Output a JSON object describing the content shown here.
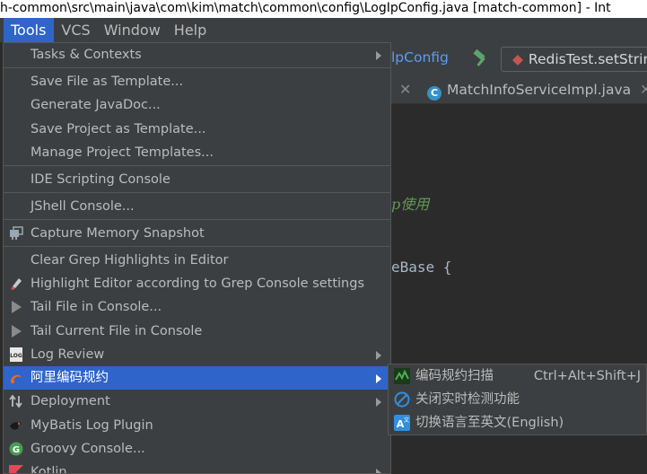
{
  "window": {
    "title": "h-common\\src\\main\\java\\com\\kim\\match\\common\\config\\LogIpConfig.java [match-common] - Int"
  },
  "menubar": {
    "tools": "Tools",
    "vcs": "VCS",
    "window": "Window",
    "help": "Help"
  },
  "editor": {
    "nav_crumb": "lpConfig",
    "run_config": "RedisTest.setStrin",
    "tab_active": "MatchInfoServiceImpl.java",
    "comment_fragment": "p使用",
    "code_fragment": "eBase {"
  },
  "tools_menu": {
    "tasks_contexts": "Tasks & Contexts",
    "save_file_as_template": "Save File as Template...",
    "generate_javadoc": "Generate JavaDoc...",
    "save_project_as_template": "Save Project as Template...",
    "manage_project_templates": "Manage Project Templates...",
    "ide_scripting_console": "IDE Scripting Console",
    "jshell_console": "JShell Console...",
    "capture_memory_snapshot": "Capture Memory Snapshot",
    "clear_grep_highlights": "Clear Grep Highlights in Editor",
    "highlight_editor_grep": "Highlight Editor according to Grep Console settings",
    "tail_file": "Tail File in Console...",
    "tail_current_file": "Tail Current File in Console",
    "log_review": "Log Review",
    "alibaba_coding": "阿里编码规约",
    "deployment": "Deployment",
    "mybatis_log_plugin": "MyBatis Log Plugin",
    "groovy_console": "Groovy Console...",
    "kotlin": "Kotlin"
  },
  "submenu": {
    "scan": "编码规约扫描",
    "scan_shortcut": "Ctrl+Alt+Shift+J",
    "close_realtime": "关闭实时检测功能",
    "switch_language": "切换语言至英文(English)"
  },
  "colors": {
    "selection": "#2f65ca",
    "menu_bg": "#3c3f41",
    "text": "#bbbbbb"
  }
}
